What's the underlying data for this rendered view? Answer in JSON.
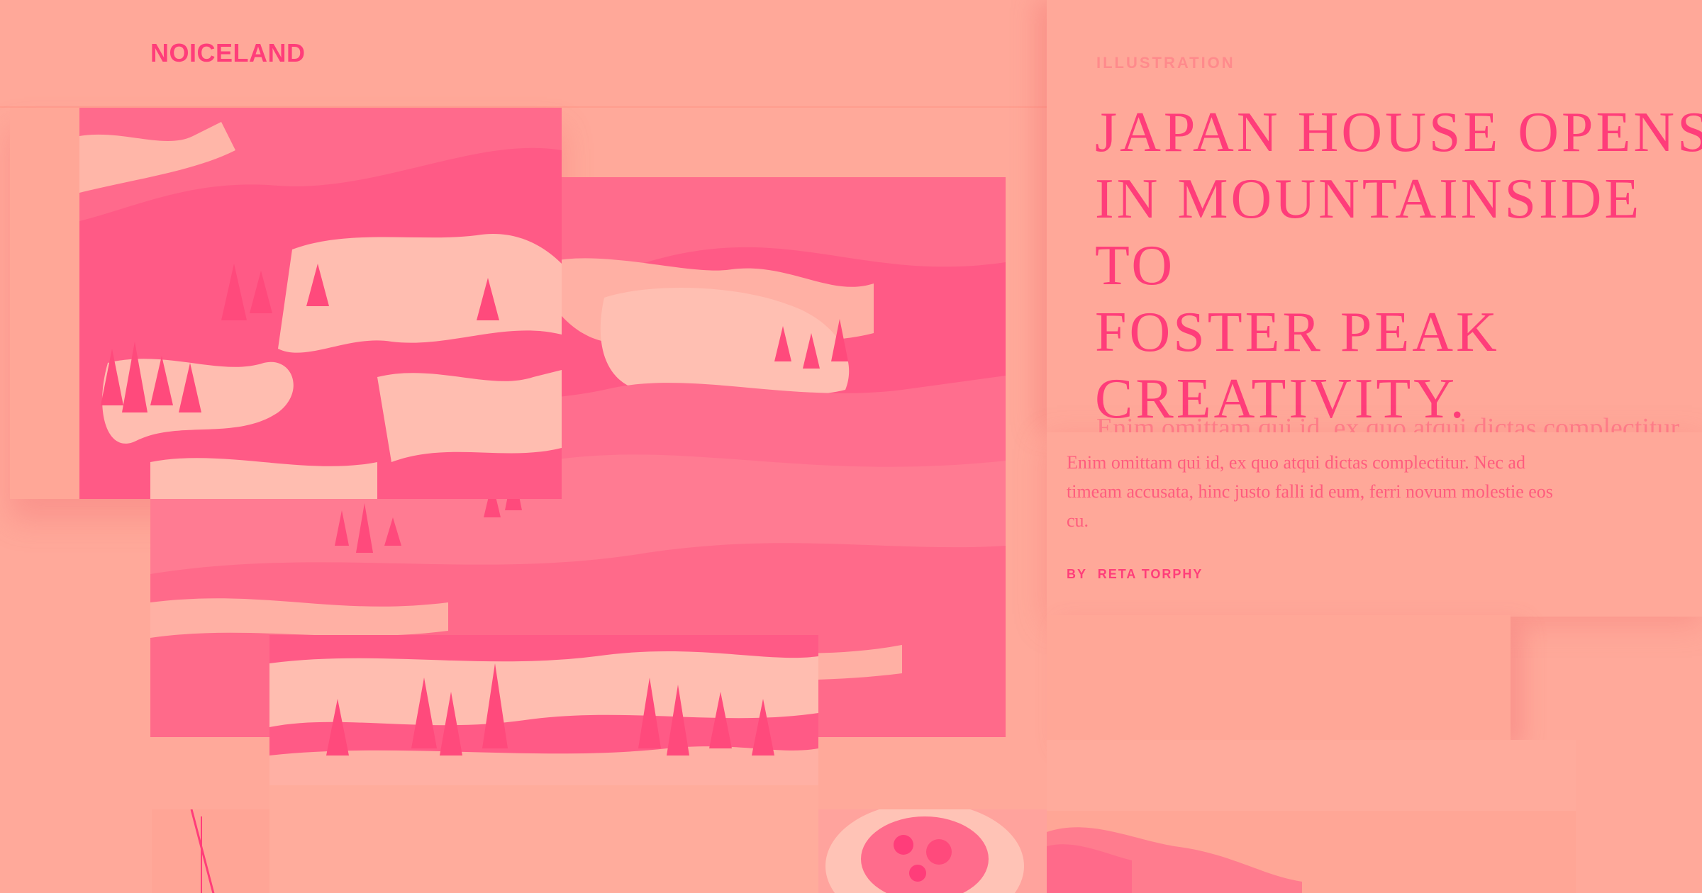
{
  "brand": {
    "logo_text": "NOICELAND"
  },
  "article": {
    "category": "ILLUSTRATION",
    "headline": "JAPAN HOUSE OPENS\nIN MOUNTAINSIDE TO\nFOSTER PEAK\nCREATIVITY.",
    "excerpt_preview": "Enim omittam qui id, ex quo atqui dictas complectitur.",
    "excerpt": "Enim omittam qui id, ex quo atqui dictas complectitur. Nec ad timeam accusata, hinc justo falli id eum, ferri novum molestie eos cu.",
    "byline_prefix": "BY",
    "author": "RETA TORPHY"
  },
  "colors": {
    "background": "#FFA99A",
    "accent": "#FF3D7A",
    "muted_text": "#FF8A8C"
  },
  "images": [
    {
      "name": "mountain-photo-top-left",
      "subject": "snowy mountain slope with pine trees"
    },
    {
      "name": "mountain-photo-main",
      "subject": "mountain ridge with snow patches"
    },
    {
      "name": "mountain-photo-bottom",
      "subject": "lake with pine trees and snow"
    },
    {
      "name": "food-photo",
      "subject": "plated dish with garnish"
    },
    {
      "name": "landscape-photo",
      "subject": "coastline landscape"
    }
  ]
}
